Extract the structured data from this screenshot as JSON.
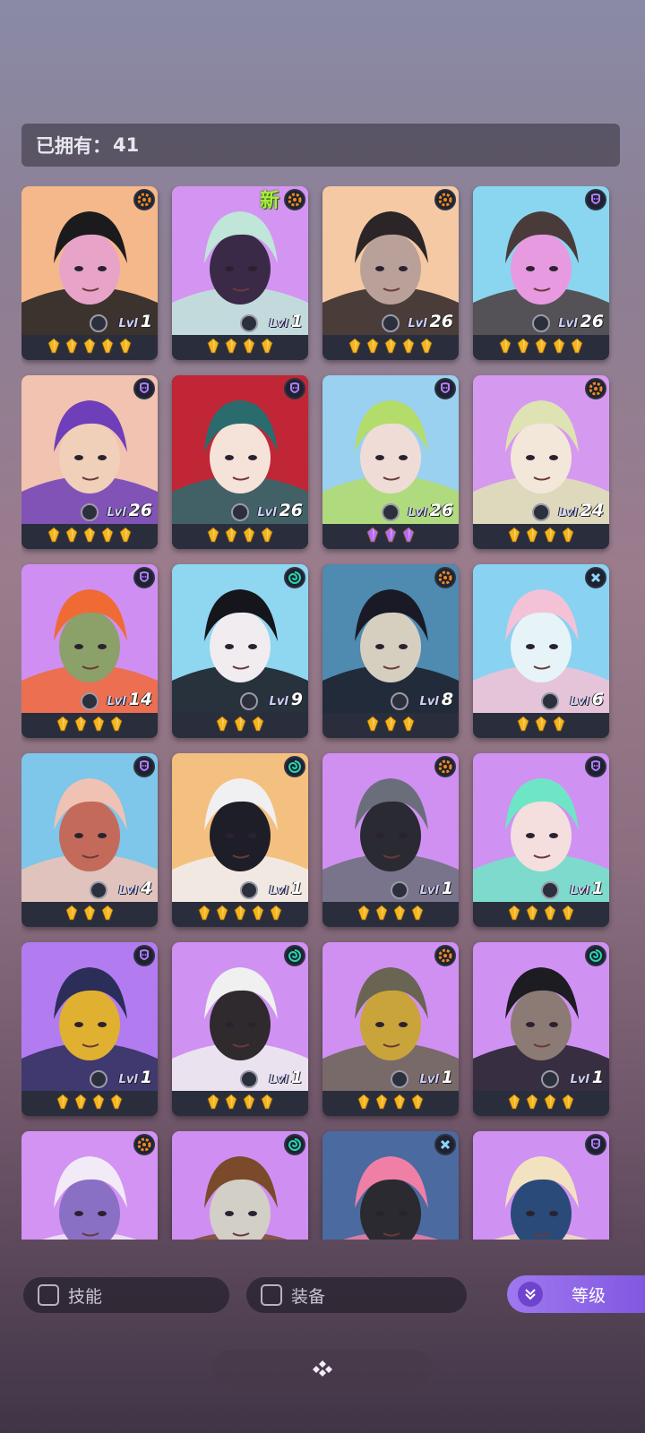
{
  "owned": {
    "label": "已拥有：",
    "count": "41"
  },
  "new_label": "新",
  "level_prefix": "Lvl",
  "colors": {
    "class_orange": "#f08a1e",
    "class_purple": "#b47cff",
    "class_teal": "#25d6b0",
    "class_blue": "#8fd4ff",
    "star_gold": "#f5b51c",
    "star_purple": "#b46cf5"
  },
  "heroes": [
    {
      "level": "1",
      "stars": 5,
      "star_color": "gold",
      "class_icon": "gear-icon",
      "is_new": false,
      "palette": [
        "#f5b88a",
        "#1b1b1e",
        "#e8a4c8"
      ]
    },
    {
      "level": "1",
      "stars": 4,
      "star_color": "gold",
      "class_icon": "gear-icon",
      "is_new": true,
      "palette": [
        "#d495f2",
        "#bfe6d9",
        "#3a2a48"
      ]
    },
    {
      "level": "26",
      "stars": 5,
      "star_color": "gold",
      "class_icon": "gear-icon",
      "is_new": false,
      "palette": [
        "#f4c9a4",
        "#2b2527",
        "#b9a19a"
      ]
    },
    {
      "level": "26",
      "stars": 5,
      "star_color": "gold",
      "class_icon": "mask-icon",
      "is_new": false,
      "palette": [
        "#8ad6f0",
        "#4a3b3b",
        "#e79ae0"
      ]
    },
    {
      "level": "26",
      "stars": 5,
      "star_color": "gold",
      "class_icon": "mask-icon",
      "is_new": false,
      "palette": [
        "#f2c3b0",
        "#6e3fb8",
        "#f0d0b8"
      ]
    },
    {
      "level": "26",
      "stars": 4,
      "star_color": "gold",
      "class_icon": "mask-icon",
      "is_new": false,
      "palette": [
        "#c02636",
        "#2a6c6e",
        "#f5e2d8"
      ]
    },
    {
      "level": "26",
      "stars": 3,
      "star_color": "purple",
      "class_icon": "mask-icon",
      "is_new": false,
      "palette": [
        "#9ad0f0",
        "#b4dc6a",
        "#f0dcd6"
      ]
    },
    {
      "level": "24",
      "stars": 4,
      "star_color": "gold",
      "class_icon": "gear-icon",
      "is_new": false,
      "palette": [
        "#d699f0",
        "#dfe3b4",
        "#f3e7da"
      ]
    },
    {
      "level": "14",
      "stars": 4,
      "star_color": "gold",
      "class_icon": "mask-icon",
      "is_new": false,
      "palette": [
        "#cf8ff2",
        "#f06a34",
        "#8ca06a"
      ]
    },
    {
      "level": "9",
      "stars": 3,
      "star_color": "gold",
      "class_icon": "swirl-icon",
      "is_new": false,
      "palette": [
        "#8fd6f0",
        "#15151c",
        "#f0ecf0"
      ]
    },
    {
      "level": "8",
      "stars": 3,
      "star_color": "gold",
      "class_icon": "gear-icon",
      "is_new": false,
      "palette": [
        "#4f8ab0",
        "#1a1a26",
        "#d6cfc0"
      ]
    },
    {
      "level": "6",
      "stars": 3,
      "star_color": "gold",
      "class_icon": "cross-icon",
      "is_new": false,
      "palette": [
        "#8ad2f2",
        "#f4c2d6",
        "#e6f4f8"
      ]
    },
    {
      "level": "4",
      "stars": 3,
      "star_color": "gold",
      "class_icon": "mask-icon",
      "is_new": false,
      "palette": [
        "#7ec6ea",
        "#f0c2b4",
        "#c46a5a"
      ]
    },
    {
      "level": "1",
      "stars": 5,
      "star_color": "gold",
      "class_icon": "swirl-icon",
      "is_new": false,
      "palette": [
        "#f4c080",
        "#f0f0f2",
        "#1e1e28"
      ]
    },
    {
      "level": "1",
      "stars": 4,
      "star_color": "gold",
      "class_icon": "gear-icon",
      "is_new": false,
      "palette": [
        "#d090f2",
        "#6a6e7a",
        "#2a2a32"
      ]
    },
    {
      "level": "1",
      "stars": 4,
      "star_color": "gold",
      "class_icon": "mask-icon",
      "is_new": false,
      "palette": [
        "#cf92f2",
        "#6ee6c6",
        "#f4dede"
      ]
    },
    {
      "level": "1",
      "stars": 4,
      "star_color": "gold",
      "class_icon": "mask-icon",
      "is_new": false,
      "palette": [
        "#b27cf0",
        "#2a2e58",
        "#e0b030"
      ]
    },
    {
      "level": "1",
      "stars": 4,
      "star_color": "gold",
      "class_icon": "swirl-icon",
      "is_new": false,
      "palette": [
        "#cf92f2",
        "#f0f0f0",
        "#2e2a2e"
      ]
    },
    {
      "level": "1",
      "stars": 4,
      "star_color": "gold",
      "class_icon": "gear-icon",
      "is_new": false,
      "palette": [
        "#d090f2",
        "#6a6452",
        "#c9a43a"
      ]
    },
    {
      "level": "1",
      "stars": 4,
      "star_color": "gold",
      "class_icon": "swirl-icon",
      "is_new": false,
      "palette": [
        "#cf92f2",
        "#1c1c22",
        "#8c7a74"
      ]
    },
    {
      "level": "",
      "stars": 0,
      "star_color": "gold",
      "class_icon": "gear-icon",
      "is_new": false,
      "palette": [
        "#d393f2",
        "#f2eaf6",
        "#8a70c4"
      ]
    },
    {
      "level": "",
      "stars": 0,
      "star_color": "gold",
      "class_icon": "swirl-icon",
      "is_new": false,
      "palette": [
        "#cf8ff2",
        "#7a4a2a",
        "#d2cfc6"
      ]
    },
    {
      "level": "",
      "stars": 0,
      "star_color": "gold",
      "class_icon": "cross-icon",
      "is_new": false,
      "palette": [
        "#4a6aa0",
        "#f07fa6",
        "#2a2a30"
      ]
    },
    {
      "level": "",
      "stars": 0,
      "star_color": "gold",
      "class_icon": "mask-icon",
      "is_new": false,
      "palette": [
        "#cf92f2",
        "#f2e2c0",
        "#2a4a7a"
      ]
    }
  ],
  "filters": {
    "skill": "技能",
    "equipment": "装备"
  },
  "sort": {
    "label": "等级"
  }
}
